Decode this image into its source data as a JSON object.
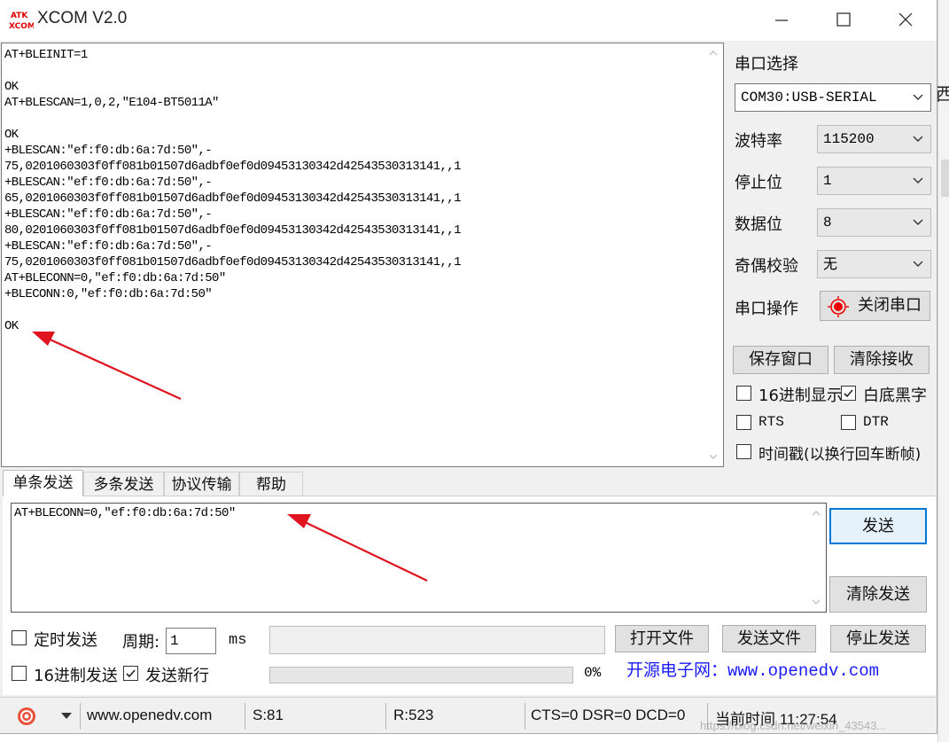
{
  "window": {
    "title": "XCOM V2.0",
    "logo_top": "ATK",
    "logo_bottom": "XCOM"
  },
  "backdrop": {
    "char": "西"
  },
  "receive": {
    "lines": [
      "AT+BLEINIT=1",
      "",
      "OK",
      "AT+BLESCAN=1,0,2,\"E104-BT5011A\"",
      "",
      "OK",
      "+BLESCAN:\"ef:f0:db:6a:7d:50\",-",
      "75,0201060303f0ff081b01507d6adbf0ef0d09453130342d42543530313141,,1",
      "+BLESCAN:\"ef:f0:db:6a:7d:50\",-",
      "65,0201060303f0ff081b01507d6adbf0ef0d09453130342d42543530313141,,1",
      "+BLESCAN:\"ef:f0:db:6a:7d:50\",-",
      "80,0201060303f0ff081b01507d6adbf0ef0d09453130342d42543530313141,,1",
      "+BLESCAN:\"ef:f0:db:6a:7d:50\",-",
      "75,0201060303f0ff081b01507d6adbf0ef0d09453130342d42543530313141,,1",
      "AT+BLECONN=0,\"ef:f0:db:6a:7d:50\"",
      "+BLECONN:0,\"ef:f0:db:6a:7d:50\"",
      "",
      "OK"
    ]
  },
  "settings": {
    "port_label": "串口选择",
    "port_value": "COM30:USB-SERIAL",
    "baud_label": "波特率",
    "baud_value": "115200",
    "stop_label": "停止位",
    "stop_value": "1",
    "data_label": "数据位",
    "data_value": "8",
    "parity_label": "奇偶校验",
    "parity_value": "无",
    "op_label": "串口操作",
    "close_port_button": "关闭串口",
    "save_window_button": "保存窗口",
    "clear_receive_button": "清除接收",
    "hex_display_label": "16进制显示",
    "hex_display_checked": false,
    "white_bg_label": "白底黑字",
    "white_bg_checked": true,
    "rts_label": "RTS",
    "rts_checked": false,
    "dtr_label": "DTR",
    "dtr_checked": false,
    "timestamp_label": "时间戳(以换行回车断帧)",
    "timestamp_checked": false
  },
  "tabs": [
    "单条发送",
    "多条发送",
    "协议传输",
    "帮助"
  ],
  "send": {
    "text": "AT+BLECONN=0,\"ef:f0:db:6a:7d:50\"",
    "send_button": "发送",
    "clear_send_button": "清除发送",
    "timed_send_label": "定时发送",
    "timed_send_checked": false,
    "period_label": "周期:",
    "period_value": "1",
    "period_unit": "ms",
    "open_file_button": "打开文件",
    "send_file_button": "发送文件",
    "stop_send_button": "停止发送",
    "hex_send_label": "16进制发送",
    "hex_send_checked": false,
    "newline_label": "发送新行",
    "newline_checked": true,
    "progress_text": "0%",
    "progress": 0,
    "promo_text": "开源电子网：www.openedv.com"
  },
  "status": {
    "website": "www.openedv.com",
    "sent": "S:81",
    "received": "R:523",
    "lines": "CTS=0 DSR=0 DCD=0",
    "time": "当前时间 11:27:54"
  },
  "watermark": "https://blog.csdn.net/weixin_43543...",
  "colors": {
    "arrow": "#e0141e",
    "accent": "#0078d7",
    "promo": "#1a1aff",
    "logo": "#e00000"
  }
}
